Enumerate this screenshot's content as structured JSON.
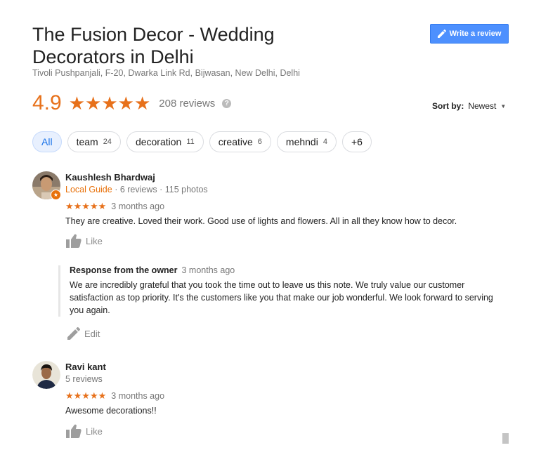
{
  "business": {
    "name": "The Fusion Decor - Wedding Decorators in Delhi",
    "address": "Tivoli Pushpanjali, F-20, Dwarka Link Rd, Bijwasan, New Delhi, Delhi"
  },
  "header": {
    "write_review_label": "Write a review",
    "rating": "4.9",
    "rating_stars": "★★★★★",
    "review_count": "208 reviews",
    "help_icon": "?",
    "sort_label": "Sort by:",
    "sort_value": "Newest"
  },
  "chips": [
    {
      "label": "All",
      "count": ""
    },
    {
      "label": "team",
      "count": "24"
    },
    {
      "label": "decoration",
      "count": "11"
    },
    {
      "label": "creative",
      "count": "6"
    },
    {
      "label": "mehndi",
      "count": "4"
    },
    {
      "label": "+6",
      "count": ""
    }
  ],
  "reviews": [
    {
      "name": "Kaushlesh Bhardwaj",
      "badge": "Local Guide",
      "meta": " · 6 reviews · 115 photos",
      "stars": "★★★★★",
      "rating_value": 5,
      "time": "3 months ago",
      "text": "They are creative. Loved their work. Good use of lights and flowers. All in all they know how to decor.",
      "like_label": "Like",
      "owner_response": {
        "heading": "Response from the owner",
        "time": "3 months ago",
        "text": "We are incredibly grateful that you took the time out to leave us this note. We truly value our customer satisfaction as top priority. It's the customers like you that make our job wonderful. We look forward to serving you again.",
        "edit_label": "Edit"
      }
    },
    {
      "name": "Ravi kant",
      "meta": "5 reviews",
      "stars": "★★★★★",
      "rating_value": 5,
      "time": "3 months ago",
      "text": "Awesome decorations!!",
      "like_label": "Like"
    }
  ],
  "colors": {
    "accent_orange": "#e7711b",
    "button_blue": "#4d90fe",
    "chip_active_bg": "#e8f0fe",
    "chip_active_text": "#1a73e8",
    "muted_text": "#777777"
  }
}
